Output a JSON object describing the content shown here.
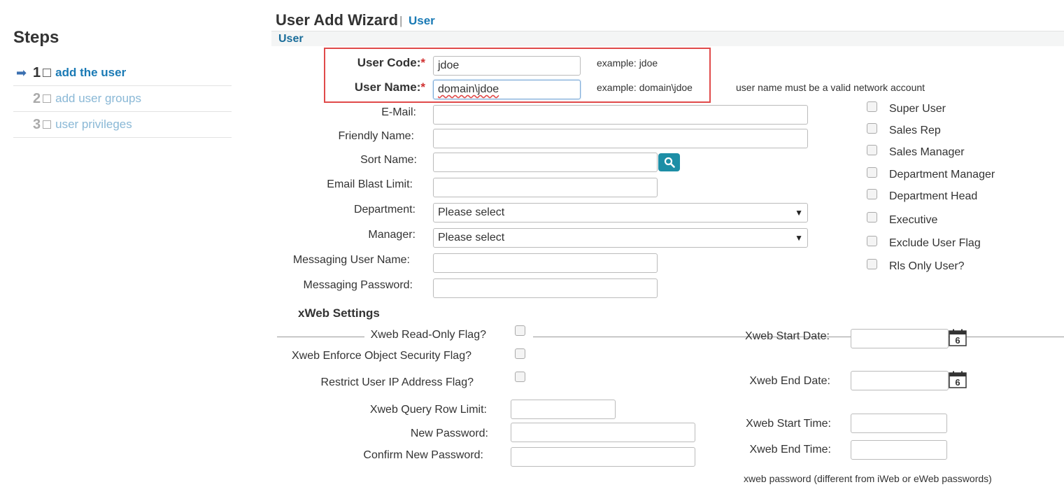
{
  "sidebar": {
    "title": "Steps",
    "steps": [
      {
        "num": "1",
        "label": "add the user",
        "active": true
      },
      {
        "num": "2",
        "label": "add user groups",
        "active": false
      },
      {
        "num": "3",
        "label": "user privileges",
        "active": false
      }
    ]
  },
  "header": {
    "title": "User Add Wizard",
    "separator": "|",
    "subtitle": "User",
    "section": "User"
  },
  "form": {
    "user_code": {
      "label": "User Code:",
      "required": "*",
      "value": "jdoe",
      "hint": "example: jdoe"
    },
    "user_name": {
      "label": "User Name:",
      "required": "*",
      "value": "domain\\jdoe",
      "hint": "example: domain\\jdoe",
      "note": "user name must be a valid network account"
    },
    "email": {
      "label": "E-Mail:",
      "value": ""
    },
    "friendly_name": {
      "label": "Friendly Name:",
      "value": ""
    },
    "sort_name": {
      "label": "Sort Name:",
      "value": ""
    },
    "email_blast_limit": {
      "label": "Email Blast Limit:",
      "value": ""
    },
    "department": {
      "label": "Department:",
      "selected": "Please select"
    },
    "manager": {
      "label": "Manager:",
      "selected": "Please select"
    },
    "messaging_user_name": {
      "label": "Messaging User Name:",
      "value": ""
    },
    "messaging_password": {
      "label": "Messaging Password:",
      "value": ""
    }
  },
  "roles": [
    "Super User",
    "Sales Rep",
    "Sales Manager",
    "Department Manager",
    "Department Head",
    "Executive",
    "Exclude User Flag",
    "Rls Only User?"
  ],
  "xweb": {
    "heading": "xWeb Settings",
    "read_only_flag": "Xweb Read-Only Flag?",
    "enforce_security_flag": "Xweb Enforce Object Security Flag?",
    "restrict_ip_flag": "Restrict User IP Address Flag?",
    "query_row_limit": "Xweb Query Row Limit:",
    "new_password": "New Password:",
    "confirm_password": "Confirm New Password:",
    "start_date": "Xweb Start Date:",
    "end_date": "Xweb End Date:",
    "start_time": "Xweb Start Time:",
    "end_time": "Xweb End Time:",
    "password_note": "xweb password (different from iWeb or eWeb passwords)",
    "calendar_day": "6"
  },
  "colors": {
    "accent": "#1a7ab5",
    "required": "#d03030",
    "highlight": "#e04a4a",
    "search_button": "#1d8ea6"
  }
}
